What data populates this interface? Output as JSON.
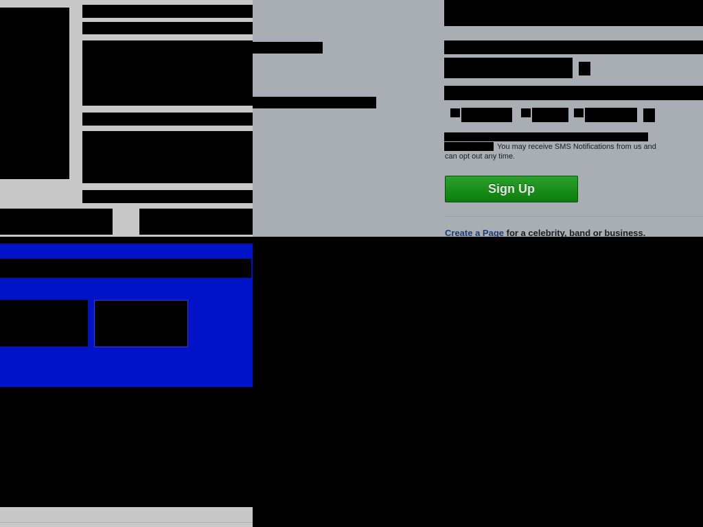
{
  "signup": {
    "sms_notice": "You may receive SMS Notifications from us and can opt out any time.",
    "signup_label": "Sign Up",
    "create_page_link": "Create a Page",
    "create_page_rest": " for a celebrity, band or business."
  },
  "colors": {
    "page_bg": "#a9adb4",
    "signup_green": "#139313",
    "panel_blue": "#0013c6",
    "link_blue": "#1c3c78"
  }
}
